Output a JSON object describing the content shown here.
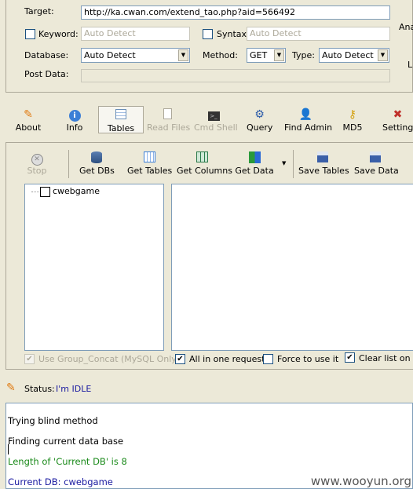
{
  "form": {
    "target_label": "Target:",
    "target_value": "http://ka.cwan.com/extend_tao.php?aid=566492",
    "keyword_label": "Keyword:",
    "keyword_placeholder": "Auto Detect",
    "syntax_label": "Syntax:",
    "syntax_placeholder": "Auto Detect",
    "database_label": "Database:",
    "database_value": "Auto Detect",
    "method_label": "Method:",
    "method_value": "GET",
    "type_label": "Type:",
    "type_value": "Auto Detect",
    "postdata_label": "Post Data:",
    "side_ana": "Ana",
    "side_l": "L"
  },
  "main_toolbar": [
    {
      "label": "About",
      "icon": "carrot-icon"
    },
    {
      "label": "Info",
      "icon": "info-icon"
    },
    {
      "label": "Tables",
      "icon": "tables-icon"
    },
    {
      "label": "Read Files",
      "icon": "file-icon"
    },
    {
      "label": "Cmd Shell",
      "icon": "terminal-icon"
    },
    {
      "label": "Query",
      "icon": "query-icon"
    },
    {
      "label": "Find Admin",
      "icon": "admin-icon"
    },
    {
      "label": "MD5",
      "icon": "key-icon"
    },
    {
      "label": "Settings",
      "icon": "tools-icon"
    }
  ],
  "tables_toolbar": [
    {
      "label": "Stop",
      "icon": "stop-icon"
    },
    {
      "label": "Get DBs",
      "icon": "database-icon"
    },
    {
      "label": "Get Tables",
      "icon": "grid-icon"
    },
    {
      "label": "Get Columns",
      "icon": "columns-icon"
    },
    {
      "label": "Get Data",
      "icon": "data-icon"
    },
    {
      "label": "Save Tables",
      "icon": "save-icon"
    },
    {
      "label": "Save Data",
      "icon": "save-icon"
    }
  ],
  "tree": {
    "db_name": "cwebgame"
  },
  "options": {
    "group_concat": "Use Group_Concat (MySQL Only)",
    "all_in_one": "All in one request.",
    "force": "Force to use it",
    "clear_list": "Clear list on ge"
  },
  "status": {
    "label": "Status:",
    "value": "I'm IDLE"
  },
  "log": [
    {
      "text": "Trying blind method",
      "color": "#000000"
    },
    {
      "text": "Finding current data base",
      "color": "#000000"
    },
    {
      "text": "Length of 'Current DB' is 8",
      "color": "#1a8a1a"
    },
    {
      "text": "Current DB: cwebgame",
      "color": "#1a1aa0"
    }
  ],
  "watermark": "www.wooyun.org",
  "colors": {
    "accent": "#1c5180",
    "status_text": "#1a1aa0"
  }
}
